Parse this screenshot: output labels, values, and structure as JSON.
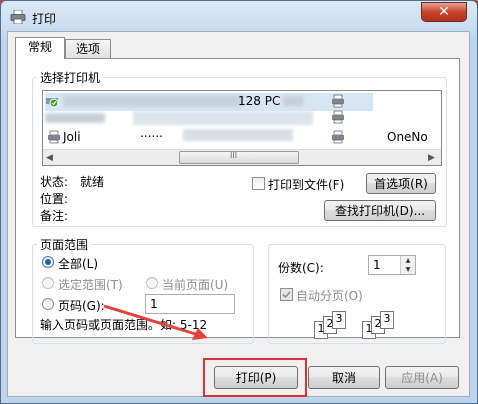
{
  "window": {
    "title": "打印",
    "close_glyph": "✕"
  },
  "tabs": [
    {
      "label": "常规"
    },
    {
      "label": "选项"
    }
  ],
  "select_printer": {
    "legend": "选择打印机",
    "items": [
      {
        "label": "128 PC"
      },
      {
        "label": "Joli"
      },
      {
        "label": "OneNo"
      }
    ],
    "dots": "......",
    "scrollbar_grip": "III"
  },
  "status": {
    "status_label": "状态:",
    "status_value": "就绪",
    "location_label": "位置:",
    "comment_label": "备注:",
    "print_to_file": "打印到文件(F)",
    "preferences_button": "首选项(R)",
    "find_printer_button": "查找打印机(D)..."
  },
  "page_range": {
    "legend": "页面范围",
    "all": "全部(L)",
    "selection": "选定范围(T)",
    "current_page": "当前页面(U)",
    "pages": "页码(G):",
    "pages_value": "1",
    "hint": "输入页码或页面范围。如: 5-12"
  },
  "copies": {
    "label": "份数(C):",
    "value": "1",
    "collate": "自动分页(O)",
    "collate_pages": [
      "1",
      "2",
      "3"
    ]
  },
  "buttons": {
    "print": "打印(P)",
    "cancel": "取消",
    "apply": "应用(A)"
  },
  "colors": {
    "highlight": "#d93434",
    "arrow": "#e8403a",
    "selected_row": "#cfe4f7"
  }
}
